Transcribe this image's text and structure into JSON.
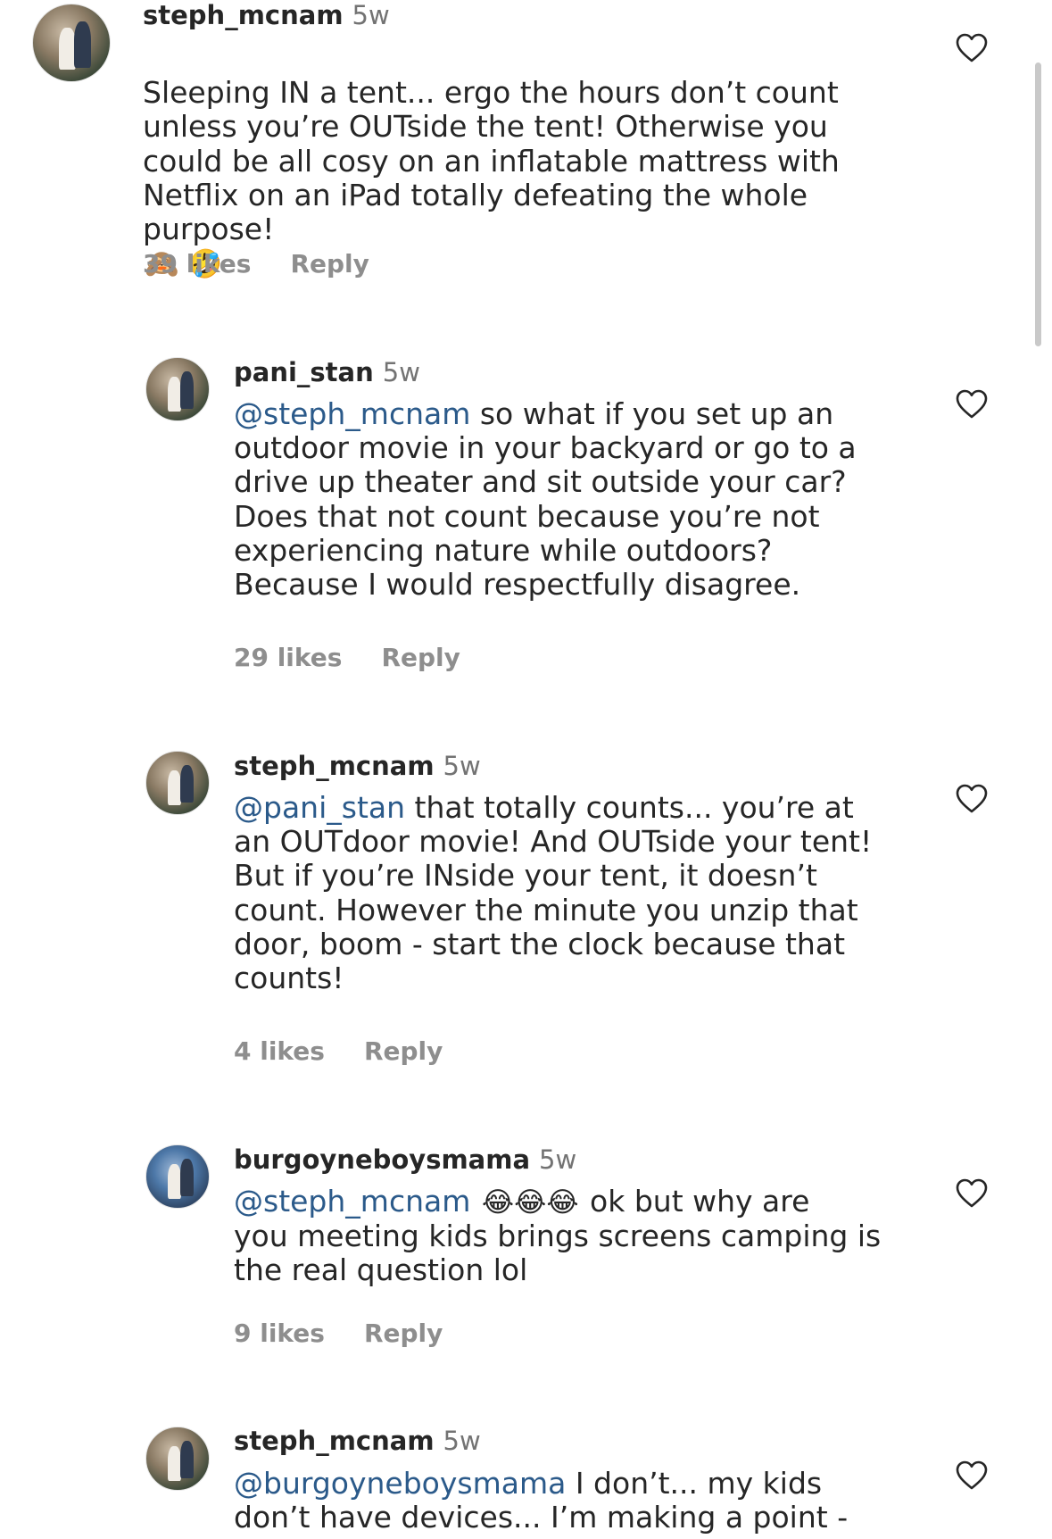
{
  "comments": [
    {
      "username": "steph_mcnam",
      "time": "5w",
      "mention": "",
      "text": "Sleeping IN a tent... ergo the hours don’t count\nunless you’re OUTside the tent! Otherwise you\ncould be all cosy on an inflatable mattress with\nNetflix on an iPad totally defeating the whole\npurpose!",
      "emoji": "🙈 🤣",
      "likes": "39 likes",
      "reply": "Reply"
    },
    {
      "username": "pani_stan",
      "time": "5w",
      "mention": "@steph_mcnam",
      "text": " so what if you set up an\noutdoor movie in your backyard or go to a\ndrive up theater and sit outside your car?\nDoes that not count because you’re not\nexperiencing nature while outdoors?\nBecause I would respectfully disagree.",
      "emoji": "",
      "likes": "29 likes",
      "reply": "Reply"
    },
    {
      "username": "steph_mcnam",
      "time": "5w",
      "mention": "@pani_stan",
      "text": " that totally counts... you’re at\nan OUTdoor movie! And OUTside your tent!\nBut if you’re INside your tent, it doesn’t\ncount. However the minute you unzip that\ndoor, boom - start the clock because that\ncounts!",
      "emoji": "",
      "likes": "4 likes",
      "reply": "Reply"
    },
    {
      "username": "burgoyneboysmama",
      "time": "5w",
      "mention": "@steph_mcnam",
      "text_before": " ",
      "emoji": "😂😂😂",
      "text": " ok but why are\nyou meeting kids brings screens camping is\nthe real question lol",
      "likes": "9 likes",
      "reply": "Reply"
    },
    {
      "username": "steph_mcnam",
      "time": "5w",
      "mention": "@burgoyneboysmama",
      "text": " I don’t... my kids\ndon’t have devices... I’m making a point -",
      "emoji": "",
      "likes": "",
      "reply": ""
    }
  ],
  "icons": {
    "like": "heart-outline-icon"
  },
  "colors": {
    "mention": "#2b5a8a",
    "meta": "#8e8e8e",
    "text": "#262626"
  }
}
